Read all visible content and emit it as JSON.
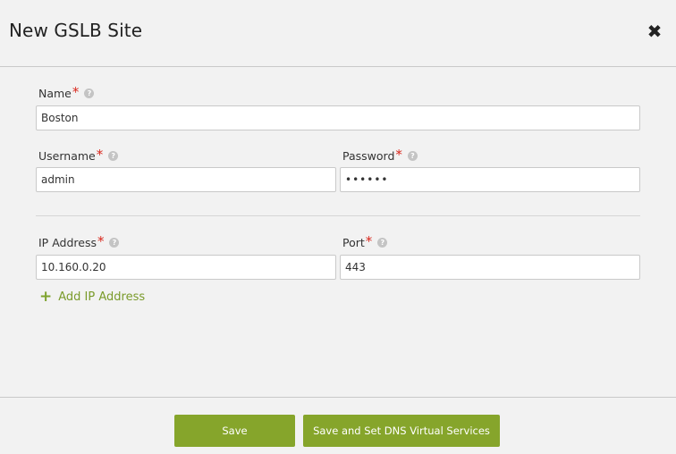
{
  "dialog": {
    "title": "New GSLB Site",
    "close_icon": "close-icon"
  },
  "form": {
    "name": {
      "label": "Name",
      "required_mark": "*",
      "value": "Boston"
    },
    "username": {
      "label": "Username",
      "required_mark": "*",
      "value": "admin"
    },
    "password": {
      "label": "Password",
      "required_mark": "*",
      "value": "••••••"
    },
    "ip_address": {
      "label": "IP Address",
      "required_mark": "*",
      "value": "10.160.0.20"
    },
    "port": {
      "label": "Port",
      "required_mark": "*",
      "value": "443"
    },
    "add_ip_label": "Add IP Address",
    "help_glyph": "?"
  },
  "footer": {
    "save_label": "Save",
    "save_dns_label": "Save and Set DNS Virtual Services"
  },
  "colors": {
    "accent": "#86a52b",
    "required": "#d9271c",
    "link": "#7a9b2b"
  }
}
